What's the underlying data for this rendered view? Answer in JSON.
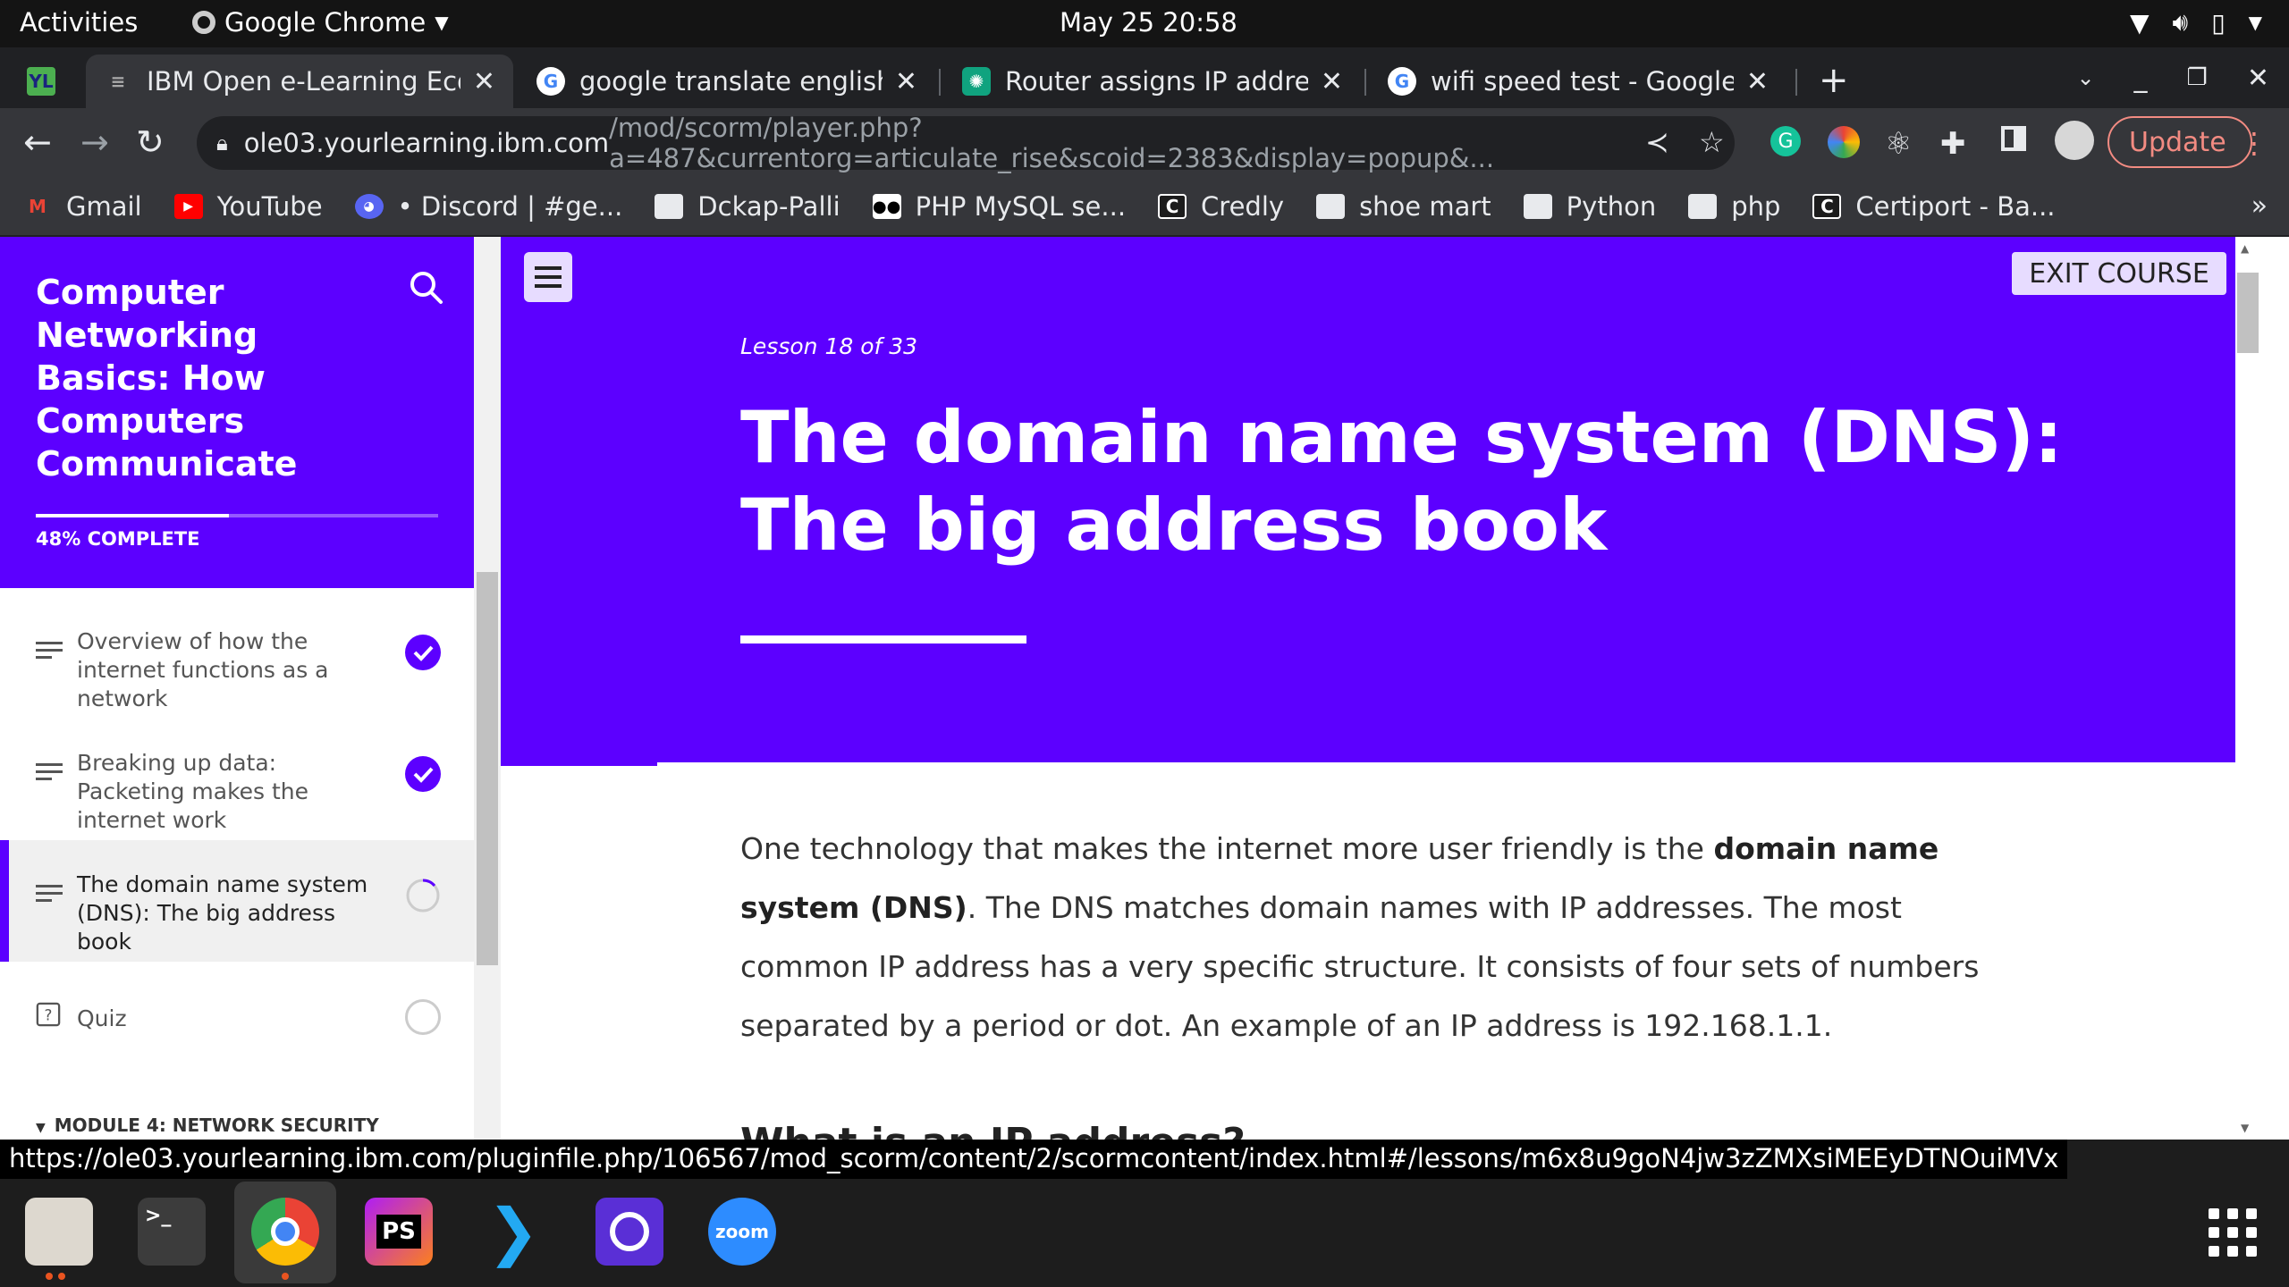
{
  "system": {
    "activities": "Activities",
    "app_name": "Google Chrome",
    "clock": "May 25  20:58"
  },
  "tabs": [
    {
      "title": "IBM Open e-Learning Ecos",
      "active": true
    },
    {
      "title": "google translate english t",
      "active": false
    },
    {
      "title": "Router assigns IP address",
      "active": false
    },
    {
      "title": "wifi speed test - Google S",
      "active": false
    }
  ],
  "toolbar": {
    "url_host": "ole03.yourlearning.ibm.com",
    "url_path": "/mod/scorm/player.php?a=487&currentorg=articulate_rise&scoid=2383&display=popup&...",
    "update_label": "Update"
  },
  "bookmarks": [
    {
      "label": "Gmail",
      "icon": "gmail-icon"
    },
    {
      "label": "YouTube",
      "icon": "youtube-icon"
    },
    {
      "label": "• Discord | #ge...",
      "icon": "discord-icon"
    },
    {
      "label": "Dckap-Palli",
      "icon": "folder-icon"
    },
    {
      "label": "PHP MySQL se...",
      "icon": "medium-icon"
    },
    {
      "label": "Credly",
      "icon": "credly-icon"
    },
    {
      "label": "shoe mart",
      "icon": "folder-icon"
    },
    {
      "label": "Python",
      "icon": "folder-icon"
    },
    {
      "label": "php",
      "icon": "folder-icon"
    },
    {
      "label": "Certiport - Ba...",
      "icon": "certiport-icon"
    }
  ],
  "sidebar": {
    "course_title": "Computer Networking Basics: How Computers Communicate",
    "progress_label": "48% COMPLETE",
    "progress_fraction": 0.48,
    "lessons": [
      {
        "label": "Overview of how the internet functions as a network",
        "status": "complete"
      },
      {
        "label": "Breaking up data: Packeting makes the internet work",
        "status": "complete"
      },
      {
        "label": "The domain name system (DNS): The big address book",
        "status": "in-progress"
      },
      {
        "label": "Quiz",
        "status": "not-started"
      }
    ],
    "module_label": "MODULE 4: NETWORK SECURITY"
  },
  "lesson": {
    "exit_label": "EXIT COURSE",
    "counter": "Lesson 18 of 33",
    "title": "The domain name system (DNS): The big address book",
    "body_pre": "One technology that makes the internet more user friendly is the ",
    "body_bold": "domain name system (DNS)",
    "body_post": ". The DNS matches domain names with IP addresses. The most common IP address has a very specific structure. It consists of four sets of numbers separated by a period or dot. An example of an IP address is 192.168.1.1.",
    "next_heading": "What is an IP address?"
  },
  "status_url": "https://ole03.yourlearning.ibm.com/pluginfile.php/106567/mod_scorm/content/2/scormcontent/index.html#/lessons/m6x8u9goN4jw3zZMXsiMEEyDTNOuiMVx",
  "dock": {
    "zoom_label": "zoom",
    "ps_label": "PS"
  }
}
